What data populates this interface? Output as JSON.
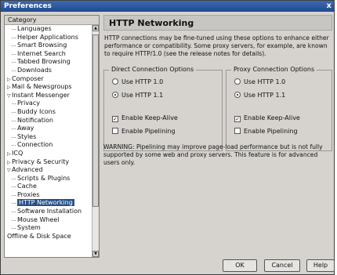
{
  "window": {
    "title": "Preferences",
    "close_glyph": "x"
  },
  "sidebar": {
    "header": "Category",
    "items": [
      {
        "label": "Languages",
        "level": 1,
        "twisty": ""
      },
      {
        "label": "Helper Applications",
        "level": 1,
        "twisty": ""
      },
      {
        "label": "Smart Browsing",
        "level": 1,
        "twisty": ""
      },
      {
        "label": "Internet Search",
        "level": 1,
        "twisty": ""
      },
      {
        "label": "Tabbed Browsing",
        "level": 1,
        "twisty": ""
      },
      {
        "label": "Downloads",
        "level": 1,
        "twisty": ""
      },
      {
        "label": "Composer",
        "level": 0,
        "twisty": "▷"
      },
      {
        "label": "Mail & Newsgroups",
        "level": 0,
        "twisty": "▷"
      },
      {
        "label": "Instant Messenger",
        "level": 0,
        "twisty": "▽"
      },
      {
        "label": "Privacy",
        "level": 1,
        "twisty": ""
      },
      {
        "label": "Buddy Icons",
        "level": 1,
        "twisty": ""
      },
      {
        "label": "Notification",
        "level": 1,
        "twisty": ""
      },
      {
        "label": "Away",
        "level": 1,
        "twisty": ""
      },
      {
        "label": "Styles",
        "level": 1,
        "twisty": ""
      },
      {
        "label": "Connection",
        "level": 1,
        "twisty": ""
      },
      {
        "label": "ICQ",
        "level": 0,
        "twisty": "▷"
      },
      {
        "label": "Privacy & Security",
        "level": 0,
        "twisty": "▷"
      },
      {
        "label": "Advanced",
        "level": 0,
        "twisty": "▽"
      },
      {
        "label": "Scripts & Plugins",
        "level": 1,
        "twisty": ""
      },
      {
        "label": "Cache",
        "level": 1,
        "twisty": ""
      },
      {
        "label": "Proxies",
        "level": 1,
        "twisty": ""
      },
      {
        "label": "HTTP Networking",
        "level": 1,
        "twisty": "",
        "selected": true
      },
      {
        "label": "Software Installation",
        "level": 1,
        "twisty": ""
      },
      {
        "label": "Mouse Wheel",
        "level": 1,
        "twisty": ""
      },
      {
        "label": "System",
        "level": 1,
        "twisty": ""
      },
      {
        "label": "Offline & Disk Space",
        "level": 0,
        "twisty": ""
      }
    ]
  },
  "main": {
    "title": "HTTP Networking",
    "description": "HTTP connections may be fine-tuned using these options to enhance either performance or compatibility. Some proxy servers, for example, are known to require HTTP/1.0 (see the release notes for details).",
    "direct": {
      "legend": "Direct Connection Options",
      "http10": "Use HTTP 1.0",
      "http11": "Use HTTP 1.1",
      "keepalive": "Enable Keep-Alive",
      "pipelining": "Enable Pipelining"
    },
    "proxy": {
      "legend": "Proxy Connection Options",
      "http10": "Use HTTP 1.0",
      "http11": "Use HTTP 1.1",
      "keepalive": "Enable Keep-Alive",
      "pipelining": "Enable Pipelining"
    },
    "warning": "WARNING: Pipelining may improve page-load performance but is not fully supported by some web and proxy servers. This feature is for advanced users only."
  },
  "buttons": {
    "ok": "OK",
    "cancel": "Cancel",
    "help": "Help"
  },
  "colors": {
    "selection": "#264f8a",
    "titlebar": "#1f4a8f"
  }
}
